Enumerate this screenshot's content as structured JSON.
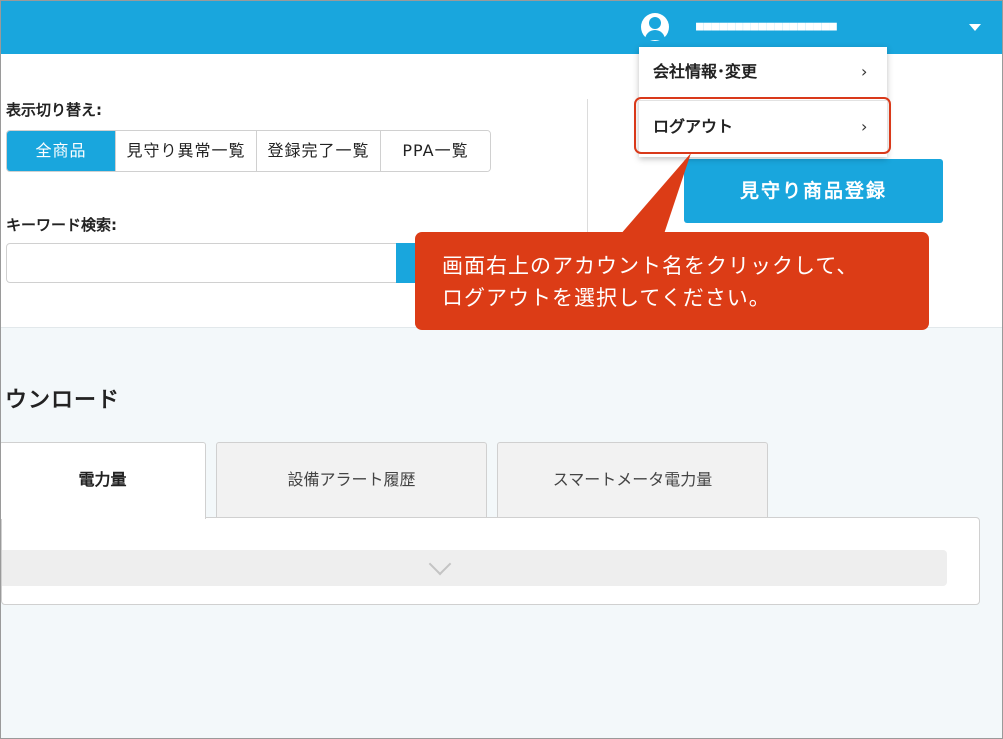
{
  "header": {
    "account_name": "■■■■■■■■■■■■■■■■■■",
    "account_menu": [
      {
        "label": "会社情報･変更",
        "arrow": "›"
      },
      {
        "label": "ログアウト",
        "arrow": "›"
      }
    ]
  },
  "filters": {
    "view_switch_label": "表示切り替え:",
    "view_options": [
      "全商品",
      "見守り異常一覧",
      "登録完了一覧",
      "PPA一覧"
    ],
    "selected_view": "全商品",
    "keyword_label": "キーワード検索:",
    "keyword_value": ""
  },
  "actions": {
    "register_label": "見守り商品登録"
  },
  "download": {
    "title": "ウンロード",
    "tabs": [
      "電力量",
      "設備アラート履歴",
      "スマートメータ電力量"
    ],
    "active_tab": "電力量"
  },
  "callout": {
    "lines": [
      "画面右上のアカウント名をクリックして、",
      "ログアウトを選択してください。"
    ]
  },
  "colors": {
    "brand": "#19a6dd",
    "callout": "#dc3c16"
  }
}
